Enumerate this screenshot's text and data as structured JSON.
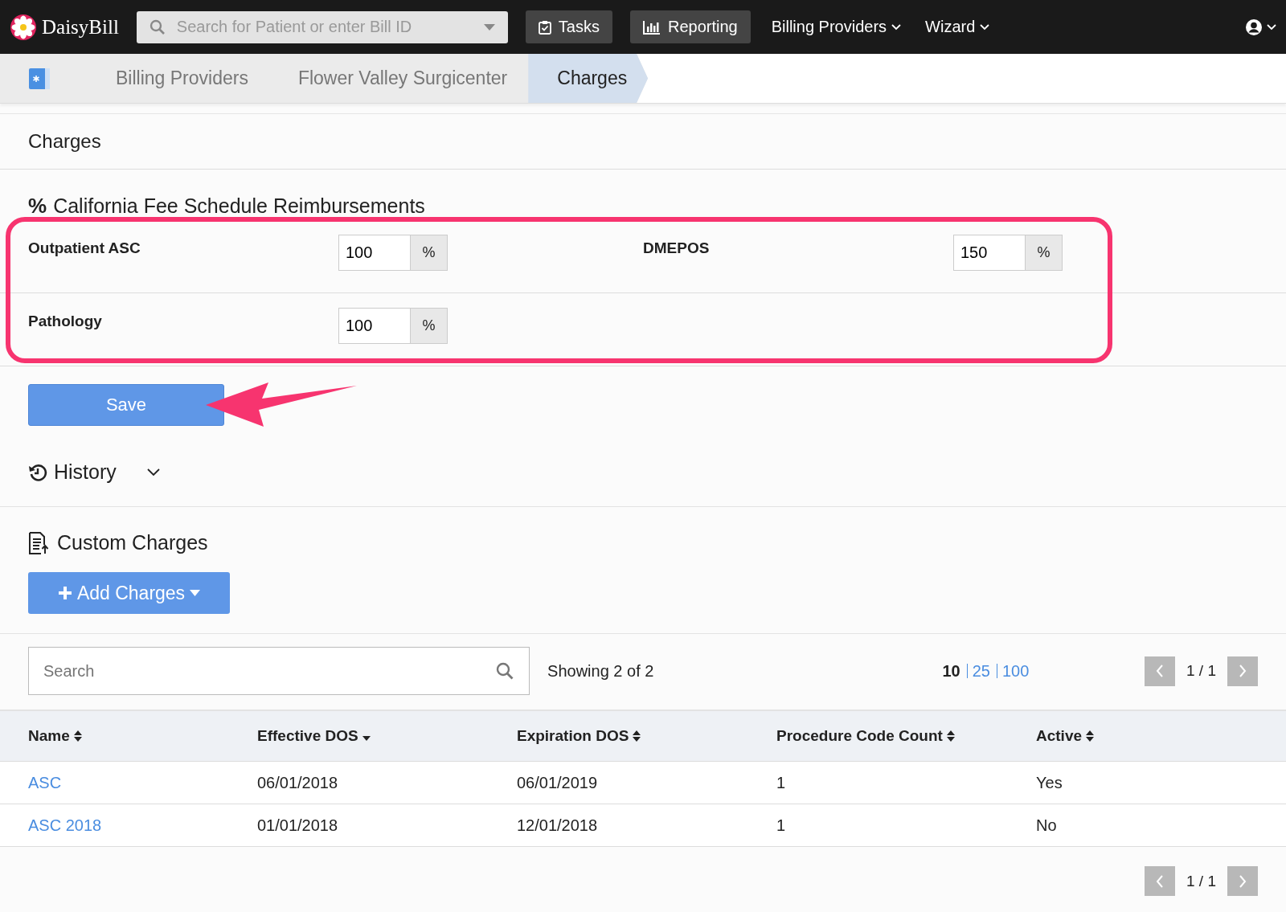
{
  "topbar": {
    "brand": "DaisyBill",
    "search": {
      "placeholder": "Search for Patient or enter Bill ID"
    },
    "nav": [
      {
        "label": "Tasks",
        "kind": "button"
      },
      {
        "label": "Reporting",
        "kind": "button"
      },
      {
        "label": "Billing Providers",
        "kind": "menu"
      },
      {
        "label": "Wizard",
        "kind": "menu"
      }
    ]
  },
  "breadcrumb": [
    {
      "label": "Billing Providers",
      "selected": false
    },
    {
      "label": "Flower Valley Surgicenter",
      "selected": false
    },
    {
      "label": "Charges",
      "selected": true
    }
  ],
  "page_title": "Charges",
  "fee_schedule": {
    "icon": "%",
    "title": "California Fee Schedule Reimbursements",
    "rows": [
      [
        {
          "label": "Outpatient ASC",
          "value": "100",
          "unit": "%"
        },
        {
          "label": "DMEPOS",
          "value": "150",
          "unit": "%"
        }
      ],
      [
        {
          "label": "Pathology",
          "value": "100",
          "unit": "%"
        }
      ]
    ],
    "save": "Save"
  },
  "history": {
    "label": "History",
    "expanded": false
  },
  "custom_charges": {
    "title": "Custom Charges",
    "add_button": "Add Charges",
    "search": {
      "placeholder": "Search"
    },
    "showing": "Showing 2 of 2",
    "page_sizes": [
      {
        "label": "10",
        "selected": true
      },
      {
        "label": "25",
        "selected": false
      },
      {
        "label": "100",
        "selected": false
      }
    ],
    "page": "1 / 1",
    "columns": [
      {
        "label": "Name",
        "kind": "sortable"
      },
      {
        "label": "Effective DOS",
        "kind": "sorted"
      },
      {
        "label": "Expiration DOS",
        "kind": "sortable"
      },
      {
        "label": "Procedure Code Count",
        "kind": "sortable"
      },
      {
        "label": "Active",
        "kind": "sortable"
      }
    ],
    "rows": [
      {
        "cells": [
          "ASC",
          "06/01/2018",
          "06/01/2019",
          "1",
          "Yes"
        ]
      },
      {
        "cells": [
          "ASC 2018",
          "01/01/2018",
          "12/01/2018",
          "1",
          "No"
        ]
      }
    ],
    "footer_page": "1 / 1"
  }
}
